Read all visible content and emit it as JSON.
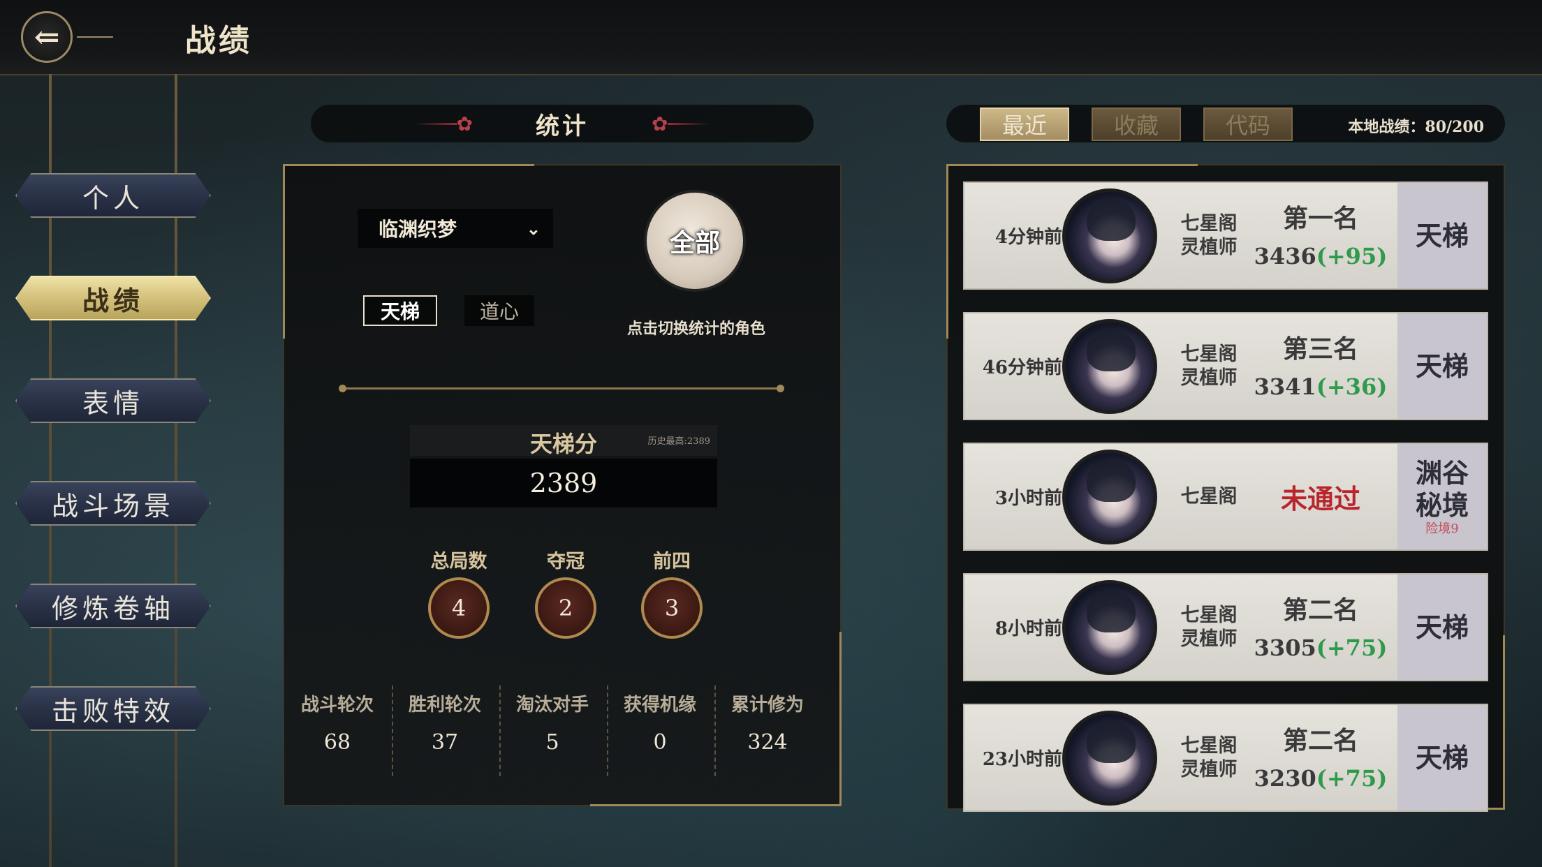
{
  "header": {
    "title": "战绩",
    "back_icon": "back-arrow-icon"
  },
  "sidebar": {
    "items": [
      {
        "label": "个人",
        "active": false
      },
      {
        "label": "战绩",
        "active": true
      },
      {
        "label": "表情",
        "active": false
      },
      {
        "label": "战斗场景",
        "active": false
      },
      {
        "label": "修炼卷轴",
        "active": false
      },
      {
        "label": "击败特效",
        "active": false
      }
    ]
  },
  "stats": {
    "header_title": "统计",
    "character_select": "临渊织梦",
    "all_button": "全部",
    "all_hint": "点击切换统计的角色",
    "tabs": {
      "ladder": "天梯",
      "daoxin": "道心"
    },
    "score_label": "天梯分",
    "score_history": "历史最高:2389",
    "score_value": "2389",
    "medals": [
      {
        "label": "总局数",
        "value": "4"
      },
      {
        "label": "夺冠",
        "value": "2"
      },
      {
        "label": "前四",
        "value": "3"
      }
    ],
    "summary": [
      {
        "label": "战斗轮次",
        "value": "68"
      },
      {
        "label": "胜利轮次",
        "value": "37"
      },
      {
        "label": "淘汰对手",
        "value": "5"
      },
      {
        "label": "获得机缘",
        "value": "0"
      },
      {
        "label": "累计修为",
        "value": "324"
      }
    ]
  },
  "records": {
    "tabs": [
      {
        "label": "最近",
        "active": true
      },
      {
        "label": "收藏",
        "active": false
      },
      {
        "label": "代码",
        "active": false
      }
    ],
    "local_count": "本地战绩：80/200",
    "items": [
      {
        "time": "4分钟前",
        "sect": "七星阁",
        "role": "灵植师",
        "rank": "第一名",
        "score": "3436",
        "delta": "(+95)",
        "mode": "天梯"
      },
      {
        "time": "46分钟前",
        "sect": "七星阁",
        "role": "灵植师",
        "rank": "第三名",
        "score": "3341",
        "delta": "(+36)",
        "mode": "天梯"
      },
      {
        "time": "3小时前",
        "sect": "七星阁",
        "result": "未通过",
        "mode_line1": "渊谷",
        "mode_line2": "秘境",
        "mode_sub": "险境9"
      },
      {
        "time": "8小时前",
        "sect": "七星阁",
        "role": "灵植师",
        "rank": "第二名",
        "score": "3305",
        "delta": "(+75)",
        "mode": "天梯"
      },
      {
        "time": "23小时前",
        "sect": "七星阁",
        "role": "灵植师",
        "rank": "第二名",
        "score": "3230",
        "delta": "(+75)",
        "mode": "天梯"
      }
    ]
  },
  "colors": {
    "gold": "#a08858",
    "delta_green": "#2f9a4a",
    "fail_red": "#b8262c"
  }
}
